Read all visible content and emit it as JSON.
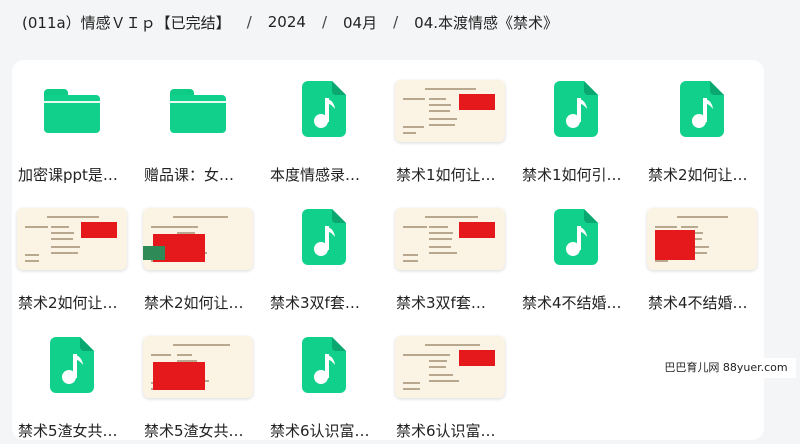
{
  "breadcrumb": {
    "items": [
      "(011a）情感ＶＩｐ【已完结】",
      "2024",
      "04月",
      "04.本渡情感《禁术》"
    ],
    "separator": "/"
  },
  "files": [
    {
      "name": "加密课ppt是…",
      "type": "folder"
    },
    {
      "name": "赠品课：女…",
      "type": "folder"
    },
    {
      "name": "本度情感录…",
      "type": "audio"
    },
    {
      "name": "禁术1如何让…",
      "type": "image"
    },
    {
      "name": "禁术1如何引…",
      "type": "audio"
    },
    {
      "name": "禁术2如何让…",
      "type": "audio"
    },
    {
      "name": "禁术2如何让…",
      "type": "image"
    },
    {
      "name": "禁术2如何让…",
      "type": "image"
    },
    {
      "name": "禁术3双f套…",
      "type": "audio"
    },
    {
      "name": "禁术3双f套…",
      "type": "image"
    },
    {
      "name": "禁术4不结婚…",
      "type": "audio"
    },
    {
      "name": "禁术4不结婚…",
      "type": "image"
    },
    {
      "name": "禁术5渣女共…",
      "type": "audio"
    },
    {
      "name": "禁术5渣女共…",
      "type": "image"
    },
    {
      "name": "禁术6认识富…",
      "type": "audio"
    },
    {
      "name": "禁术6认识富…",
      "type": "image"
    }
  ],
  "watermark": "巴巴育儿网 88yuer.com",
  "colors": {
    "icon_green": "#10d08b",
    "doc_bg": "#fbf3e4",
    "doc_red": "#e5191c"
  }
}
